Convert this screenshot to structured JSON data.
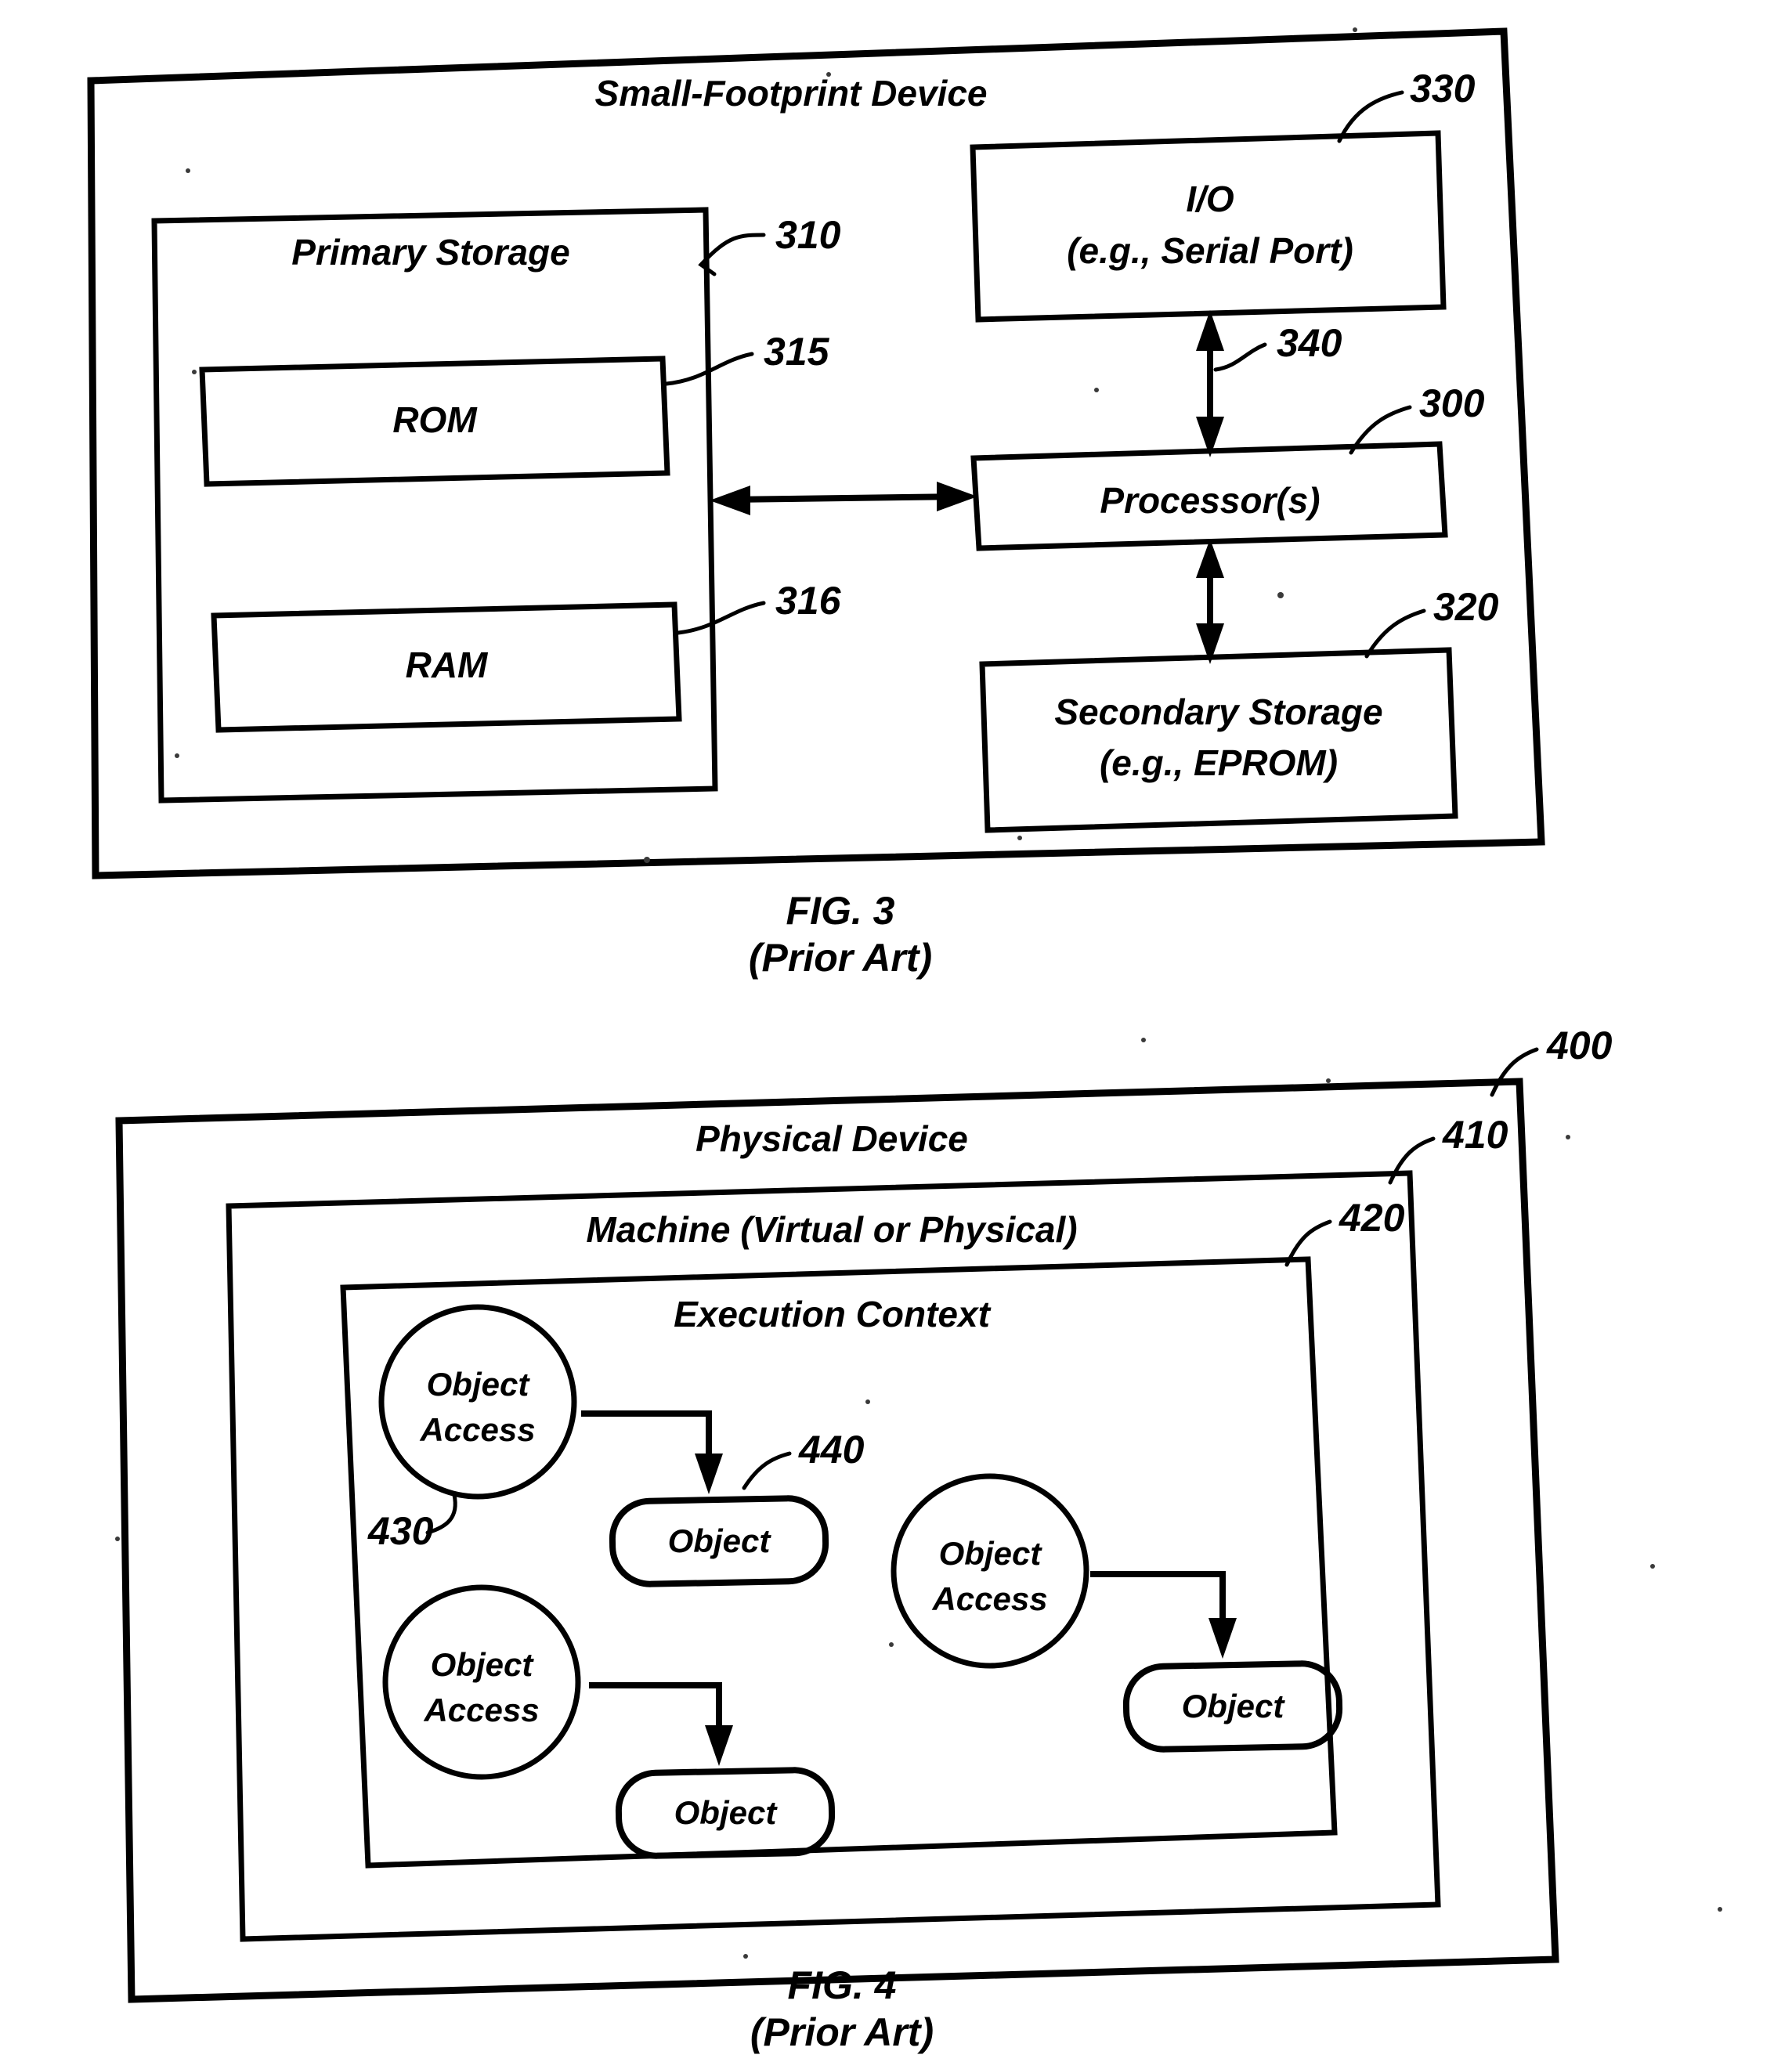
{
  "page": {
    "background": "#ffffff",
    "ink": "#000000"
  },
  "figures": [
    {
      "id": "fig3",
      "caption_line1": "FIG. 3",
      "caption_line2": "(Prior Art)",
      "outer_box_title": "Small-Footprint Device",
      "blocks": [
        {
          "key": "primary_storage",
          "label": "Primary Storage",
          "ref": "310"
        },
        {
          "key": "rom",
          "label": "ROM",
          "ref": "315"
        },
        {
          "key": "ram",
          "label": "RAM",
          "ref": "316"
        },
        {
          "key": "io",
          "label_line1": "I/O",
          "label_line2": "(e.g., Serial Port)",
          "ref": "330"
        },
        {
          "key": "processor",
          "label": "Processor(s)",
          "ref": "300"
        },
        {
          "key": "secondary_storage",
          "label_line1": "Secondary Storage",
          "label_line2": "(e.g., EPROM)",
          "ref": "320"
        }
      ],
      "connections": [
        {
          "key": "bus_io_processor",
          "ref": "340",
          "type": "double-arrow-vertical"
        },
        {
          "key": "bus_processor_secondary",
          "ref": "",
          "type": "double-arrow-vertical"
        },
        {
          "key": "bus_primary_processor",
          "ref": "",
          "type": "double-arrow-horizontal"
        }
      ]
    },
    {
      "id": "fig4",
      "caption_line1": "FIG. 4",
      "caption_line2": "(Prior Art)",
      "containers": [
        {
          "key": "physical_device",
          "label": "Physical Device",
          "ref": "400"
        },
        {
          "key": "machine",
          "label": "Machine (Virtual or Physical)",
          "ref": "410"
        },
        {
          "key": "execution_context",
          "label": "Execution Context",
          "ref": "420"
        }
      ],
      "nodes": [
        {
          "key": "object_access_1",
          "label_line1": "Object",
          "label_line2": "Access",
          "ref": "430"
        },
        {
          "key": "object_1",
          "label": "Object",
          "ref": "440"
        },
        {
          "key": "object_access_2",
          "label_line1": "Object",
          "label_line2": "Access",
          "ref": ""
        },
        {
          "key": "object_2",
          "label": "Object",
          "ref": ""
        },
        {
          "key": "object_access_3",
          "label_line1": "Object",
          "label_line2": "Access",
          "ref": ""
        },
        {
          "key": "object_3",
          "label": "Object",
          "ref": ""
        }
      ]
    }
  ]
}
